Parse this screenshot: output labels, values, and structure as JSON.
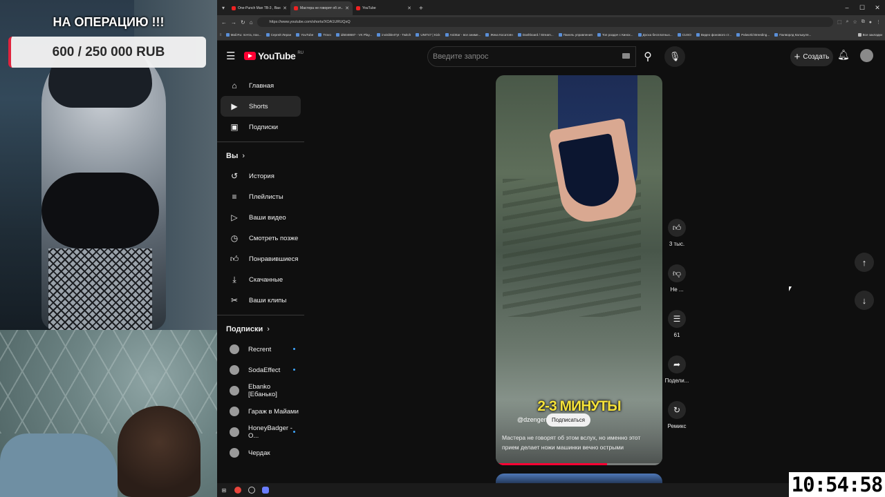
{
  "overlay": {
    "donation_title": "НА ОПЕРАЦИЮ !!!",
    "donation_amount": "600 / 250 000 RUB",
    "accent_color": "#e0233d"
  },
  "browser": {
    "tabs": [
      {
        "title": "One-Punch Man TB-3 , Ван Па...",
        "active": false
      },
      {
        "title": "Мастера не говорят об эт...",
        "active": true
      },
      {
        "title": "YouTube",
        "active": false
      }
    ],
    "new_tab_symbol": "+",
    "url": "https://www.youtube.com/shorts/XOA1URUQsQ",
    "bookmarks": [
      "Mail.Ru: почта, пои...",
      "Сергей Леран",
      "YouTube",
      "Trovo",
      "id5048687 - VK Play...",
      "invisible47yt - Twitch",
      "UNIT47 | Kick",
      "AniStar - все аниме...",
      "Жека Косатоян",
      "Dashboard / Stream...",
      "Панель управления",
      "Топ раздач с Кинох...",
      "Доска бесплатных...",
      "CUSO",
      "Видео фонового ст...",
      "Palworld Breeding...",
      "Палворлд Калькуля..."
    ],
    "bookmarks_all": "Все закладки"
  },
  "youtube": {
    "logo_text": "YouTube",
    "region": "RU",
    "search_placeholder": "Введите запрос",
    "create_label": "Создать",
    "nav": [
      {
        "label": "Главная",
        "icon": "home-icon",
        "active": false
      },
      {
        "label": "Shorts",
        "icon": "shorts-icon",
        "active": true
      },
      {
        "label": "Подписки",
        "icon": "subscriptions-icon",
        "active": false
      }
    ],
    "you_header": "Вы",
    "you_items": [
      {
        "label": "История",
        "icon": "history-icon"
      },
      {
        "label": "Плейлисты",
        "icon": "playlists-icon"
      },
      {
        "label": "Ваши видео",
        "icon": "your-videos-icon"
      },
      {
        "label": "Смотреть позже",
        "icon": "watch-later-icon"
      },
      {
        "label": "Понравившиеся",
        "icon": "liked-icon"
      },
      {
        "label": "Скачанные",
        "icon": "downloads-icon"
      },
      {
        "label": "Ваши клипы",
        "icon": "clips-icon"
      }
    ],
    "subs_header": "Подписки",
    "subscriptions": [
      {
        "name": "Recrent",
        "new": true
      },
      {
        "name": "SodaEffect",
        "new": true
      },
      {
        "name": "Ebanko [Ебанько]",
        "new": false
      },
      {
        "name": "Гараж в Майами",
        "new": false
      },
      {
        "name": "HoneyBadger - O...",
        "new": true
      },
      {
        "name": "Чердак",
        "new": false
      }
    ],
    "short": {
      "overlay_text": "2-3 МИНУТЫ",
      "channel": "@dzengen",
      "subscribe_label": "Подписаться",
      "description": "Мастера не говорят об этом вслух, но именно этот прием делает ножи машинки вечно острыми",
      "progress": 0.67
    },
    "actions": [
      {
        "label": "3 тыс.",
        "icon": "like-icon"
      },
      {
        "label": "Не ...",
        "icon": "dislike-icon"
      },
      {
        "label": "61",
        "icon": "comments-icon"
      },
      {
        "label": "Подели...",
        "icon": "share-icon"
      },
      {
        "label": "Ремикс",
        "icon": "remix-icon"
      }
    ]
  },
  "clock": "10:54:58"
}
